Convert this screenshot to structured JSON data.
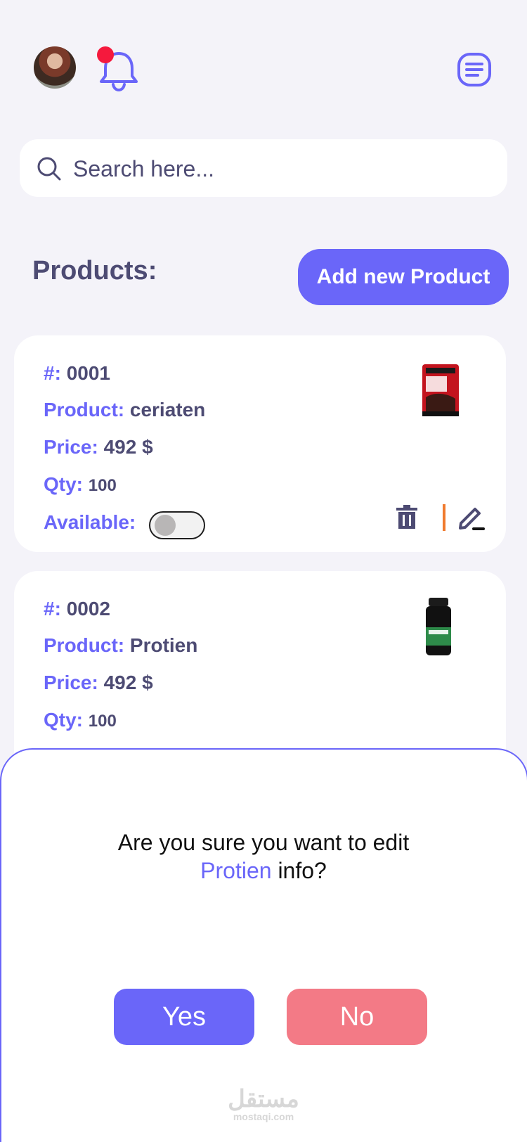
{
  "header": {
    "avatar_alt": "User avatar",
    "notification_dot_color": "#f5193d",
    "menu_icon": "menu-icon"
  },
  "search": {
    "placeholder": "Search here..."
  },
  "products": {
    "title": "Products:",
    "add_button_label": "Add new Product",
    "items": [
      {
        "id_label": "#:",
        "id_value": "0001",
        "product_label": "Product:",
        "product_value": "ceriaten",
        "price_label": "Price:",
        "price_value": "492 $",
        "qty_label": "Qty:",
        "qty_value": "100",
        "available_label": "Available:",
        "available": false,
        "image_icon": "whey-protein-bag"
      },
      {
        "id_label": "#:",
        "id_value": "0002",
        "product_label": "Product:",
        "product_value": "Protien",
        "price_label": "Price:",
        "price_value": "492 $",
        "qty_label": "Qty:",
        "qty_value": "100",
        "image_icon": "creatine-bottle"
      }
    ]
  },
  "modal": {
    "question_line1": "Are you sure you want to edit",
    "question_name": "Protien",
    "question_suffix": " info?",
    "yes_label": "Yes",
    "no_label": "No"
  },
  "watermark": {
    "arabic": "مستقل",
    "latin": "mostaqi.com"
  },
  "colors": {
    "accent": "#6a66f9",
    "text": "#4d4b73",
    "danger": "#f37a86",
    "separator": "#f07a2e"
  }
}
